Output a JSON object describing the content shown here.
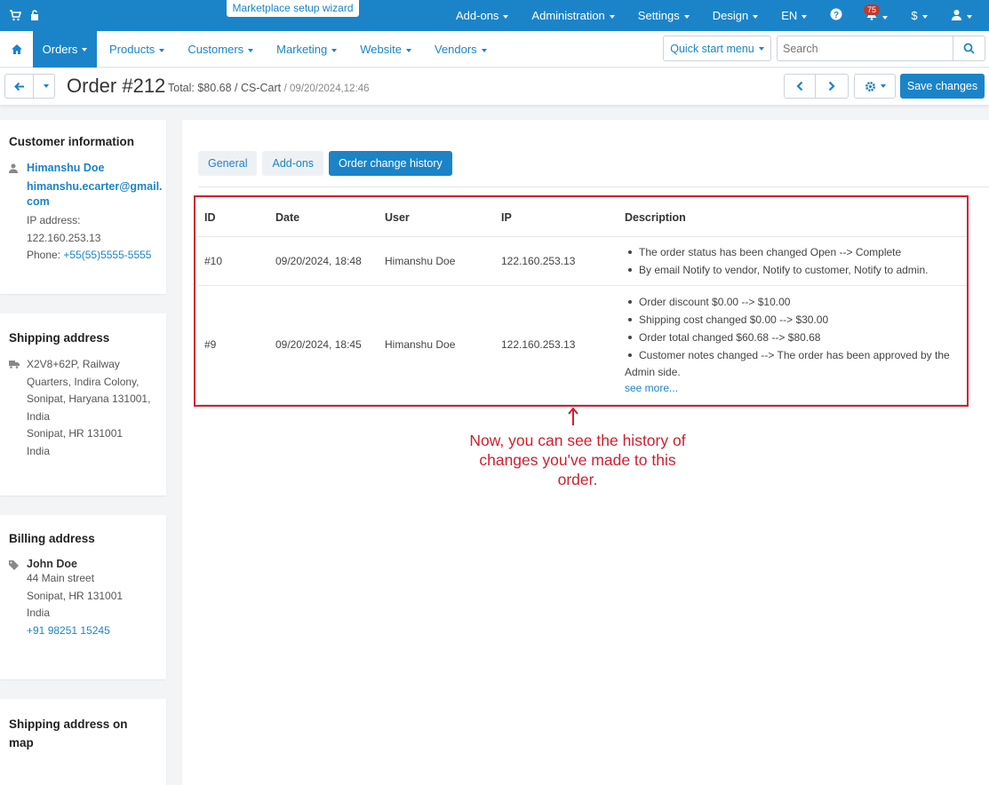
{
  "topbar": {
    "wizard_label": "Marketplace setup wizard",
    "menu": [
      "Add-ons",
      "Administration",
      "Settings",
      "Design",
      "EN"
    ],
    "notifications_count": "75",
    "currency": "$",
    "icons": [
      "cart-icon",
      "lock-icon",
      "help-icon",
      "bell-icon",
      "user-icon"
    ]
  },
  "nav": {
    "orders": "Orders",
    "items": [
      "Products",
      "Customers",
      "Marketing",
      "Website",
      "Vendors"
    ],
    "quick_start": "Quick start menu",
    "search_placeholder": "Search"
  },
  "titlebar": {
    "title": "Order #212",
    "summary": "Total: $80.68 / CS-Cart",
    "date": "/ 09/20/2024,12:46",
    "save_label": "Save changes"
  },
  "customer": {
    "heading": "Customer information",
    "name": "Himanshu Doe",
    "email_1": "himanshu.ecarter@gmail.",
    "email_2": "com",
    "ip_label": "IP address:",
    "ip": "122.160.253.13",
    "phone_label": "Phone:",
    "phone": "+55(55)5555-5555"
  },
  "shipping": {
    "heading": "Shipping address",
    "lines": [
      "X2V8+62P, Railway",
      "Quarters, Indira Colony,",
      "Sonipat, Haryana 131001,",
      "India",
      "Sonipat, HR 131001",
      "India"
    ]
  },
  "billing": {
    "heading": "Billing address",
    "name": "John Doe",
    "lines": [
      "44 Main street",
      "Sonipat, HR 131001",
      "India"
    ],
    "phone": "+91 98251 15245"
  },
  "shipping_map": {
    "heading_1": "Shipping address on",
    "heading_2": "map"
  },
  "tabs": [
    "General",
    "Add-ons",
    "Order change history"
  ],
  "history": {
    "headers": [
      "ID",
      "Date",
      "User",
      "IP",
      "Description"
    ],
    "rows": [
      {
        "id": "#10",
        "date": "09/20/2024, 18:48",
        "user": "Himanshu Doe",
        "ip": "122.160.253.13",
        "items": [
          "The order status has been changed  Open --> Complete",
          "By email Notify to vendor, Notify to customer, Notify to admin."
        ]
      },
      {
        "id": "#9",
        "date": "09/20/2024, 18:45",
        "user": "Himanshu Doe",
        "ip": "122.160.253.13",
        "items": [
          "Order discount   $0.00 --> $10.00",
          "Shipping cost changed   $0.00 --> $30.00",
          "Order total changed   $60.68 --> $80.68",
          "Customer notes changed    --> The order has been approved by the"
        ],
        "continuation": "Admin side.",
        "see_more": "see more..."
      }
    ]
  },
  "annotation": {
    "line_1": "Now, you can see the history of",
    "line_2": "changes you've made to this",
    "line_3": "order."
  },
  "colors": {
    "primary": "#1b84c9",
    "annotation": "#d0202e"
  }
}
